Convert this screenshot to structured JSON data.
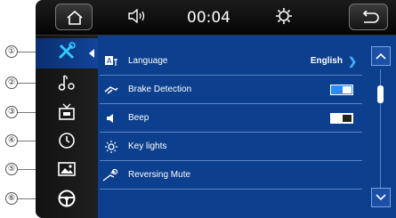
{
  "callouts": [
    "①",
    "②",
    "③",
    "④",
    "⑤",
    "⑥"
  ],
  "topbar": {
    "time": "00:04",
    "icons": [
      "home-icon",
      "volume-icon",
      "brightness-icon",
      "back-icon"
    ]
  },
  "sidebar": {
    "items": [
      {
        "icon": "tools-icon",
        "active": true
      },
      {
        "icon": "sound-settings-icon",
        "active": false
      },
      {
        "icon": "tv-icon",
        "active": false
      },
      {
        "icon": "clock-icon",
        "active": false
      },
      {
        "icon": "picture-icon",
        "active": false
      },
      {
        "icon": "steering-wheel-icon",
        "active": false
      }
    ]
  },
  "settings": {
    "rows": [
      {
        "icon": "language-icon",
        "label": "Language",
        "value": "English"
      },
      {
        "icon": "brake-icon",
        "label": "Brake Detection",
        "toggle": "on"
      },
      {
        "icon": "beep-icon",
        "label": "Beep",
        "toggle": "off"
      },
      {
        "icon": "key-lights-icon",
        "label": "Key lights"
      },
      {
        "icon": "reversing-mute-icon",
        "label": "Reversing Mute"
      }
    ]
  },
  "scroll": {
    "position": 0.1
  },
  "colors": {
    "background": "#0c3f8e",
    "accent": "#2b8cff",
    "chevron": "#49a6ff"
  }
}
